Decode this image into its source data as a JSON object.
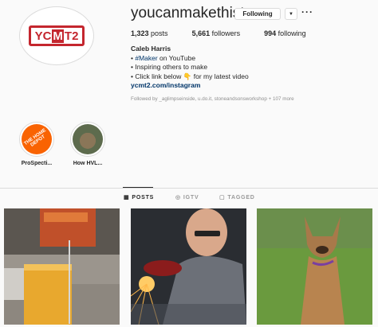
{
  "profile": {
    "username": "youcanmakethistoo",
    "avatar_logo": "YCMT2",
    "following_button": "Following",
    "dropdown_icon": "chevron-down-icon",
    "more_icon": "more-horizontal-icon",
    "stats": {
      "posts_count": "1,323",
      "posts_label": "posts",
      "followers_count": "5,661",
      "followers_label": "followers",
      "following_count": "994",
      "following_label": "following"
    },
    "bio": {
      "name": "Caleb Harris",
      "line1_prefix": "• ",
      "line1_tag": "#Maker",
      "line1_suffix": " on YouTube",
      "line2": "• Inspiring others to make",
      "line3": "• Click link below 👇 for my latest video",
      "link": "ycmt2.com/instagram"
    },
    "followed_by": "Followed by _aglimpseinside, u.do.it, stoneandsonsworkshop + 107 more"
  },
  "highlights": [
    {
      "label": "ProSpecti...",
      "thumb_text": "THE HOME DEPOT"
    },
    {
      "label": "How HVL..."
    }
  ],
  "tabs": [
    {
      "label": "POSTS",
      "icon": "grid-icon"
    },
    {
      "label": "IGTV",
      "icon": "igtv-icon"
    },
    {
      "label": "TAGGED",
      "icon": "tag-icon"
    }
  ],
  "colors": {
    "accent_link": "#003569",
    "brand_red": "#c4262e",
    "home_depot_orange": "#f96302"
  }
}
